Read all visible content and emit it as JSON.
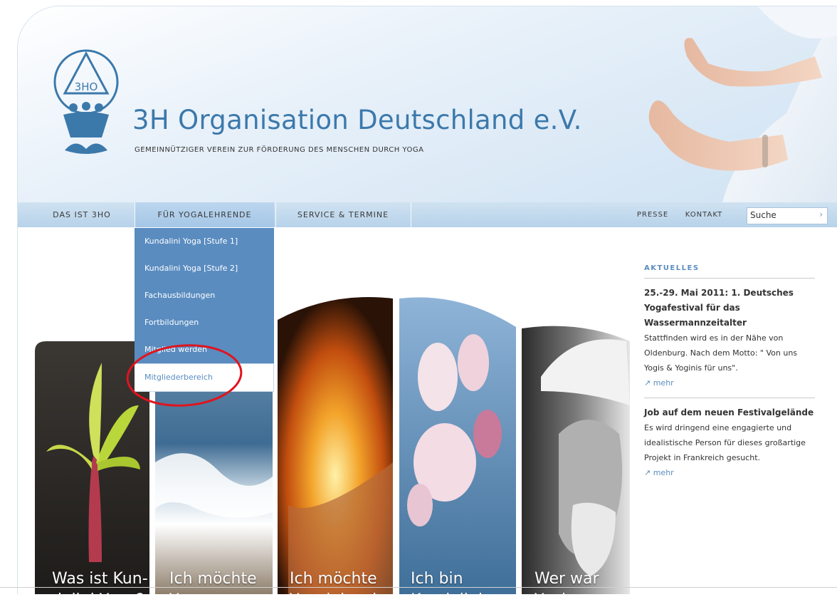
{
  "header": {
    "logo_text": "3HO",
    "title": "3H Organisation Deutschland e.V.",
    "subtitle": "GEMEINNÜTZIGER VEREIN ZUR FÖRDERUNG DES MENSCHEN DURCH YOGA"
  },
  "nav": {
    "main": [
      "DAS IST 3HO",
      "FÜR YOGALEHRENDE",
      "SERVICE & TERMINE"
    ],
    "right": [
      "PRESSE",
      "KONTAKT"
    ]
  },
  "search": {
    "value": "Suche",
    "go_icon": "chevron-right-icon"
  },
  "dropdown": {
    "items": [
      "Kundalini Yoga [Stufe 1]",
      "Kundalini Yoga [Stufe 2]",
      "Fachausbildungen",
      "Fortbildungen",
      "Mitglied werden",
      "Mitgliederbereich"
    ],
    "selected_index": 5
  },
  "tiles": [
    {
      "label": "Was ist Kun-\ndalini Yoga?"
    },
    {
      "label": "Ich möchte\nYoga"
    },
    {
      "label": "Ich möchte\nYogalehrerin"
    },
    {
      "label": "Ich bin\nKundalini"
    },
    {
      "label": "Wer war\nYogi"
    }
  ],
  "news": {
    "heading": "AKTUELLES",
    "items": [
      {
        "title": "25.-29. Mai 2011: 1. Deutsches Yogafestival für das Wassermannzeitalter",
        "body": "Stattfinden wird es in der Nähe von Oldenburg. Nach dem Motto: \" Von uns Yogis & Yoginis für uns\".",
        "more": "mehr"
      },
      {
        "title": "Job auf dem neuen Festivalgelände",
        "body": "Es wird dringend eine engagierte und idealistische Person für dieses großartige Projekt in Frankreich gesucht.",
        "more": "mehr"
      }
    ]
  },
  "colors": {
    "brand_blue": "#3c79ab",
    "menu_blue": "#5a8cc0",
    "annotation_red": "#e0141e"
  }
}
